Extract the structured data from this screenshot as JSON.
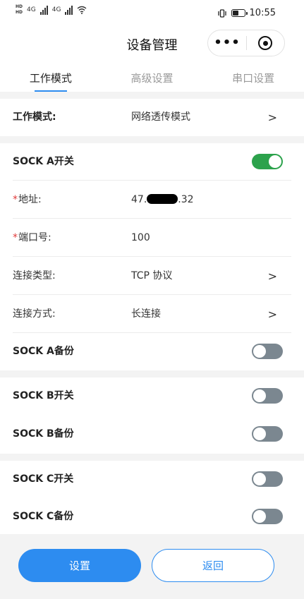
{
  "status_bar": {
    "network_left": "HD",
    "network_sub": "HD",
    "net_gen_1": "4G",
    "net_gen_2": "4G",
    "time": "10:55"
  },
  "header": {
    "title": "设备管理",
    "menu_icon": "more-dots-icon",
    "close_icon": "target-circle-icon"
  },
  "tabs": [
    {
      "label": "工作模式",
      "active": true
    },
    {
      "label": "高级设置",
      "active": false
    },
    {
      "label": "串口设置",
      "active": false
    }
  ],
  "work_mode": {
    "label": "工作模式:",
    "value": "网络透传模式"
  },
  "sock_a": {
    "switch_label": "SOCK A开关",
    "switch_on": true,
    "address_label": "地址:",
    "address_prefix": "47.",
    "address_suffix": ".32",
    "port_label": "端口号:",
    "port_value": "100",
    "conn_type_label": "连接类型:",
    "conn_type_value": "TCP 协议",
    "conn_mode_label": "连接方式:",
    "conn_mode_value": "长连接",
    "backup_label": "SOCK A备份",
    "backup_on": false
  },
  "sock_b": {
    "switch_label": "SOCK B开关",
    "switch_on": false,
    "backup_label": "SOCK B备份",
    "backup_on": false
  },
  "sock_c": {
    "switch_label": "SOCK C开关",
    "switch_on": false,
    "backup_label": "SOCK C备份",
    "backup_on": false
  },
  "required_mark": "*",
  "chevron": ">",
  "footer": {
    "submit_label": "设置",
    "back_label": "返回"
  },
  "colors": {
    "accent": "#2d8cf0",
    "toggle_on": "#2ca24c",
    "toggle_off": "#7b8790",
    "required": "#e03b3b",
    "section_gap": "#f3f3f3"
  }
}
